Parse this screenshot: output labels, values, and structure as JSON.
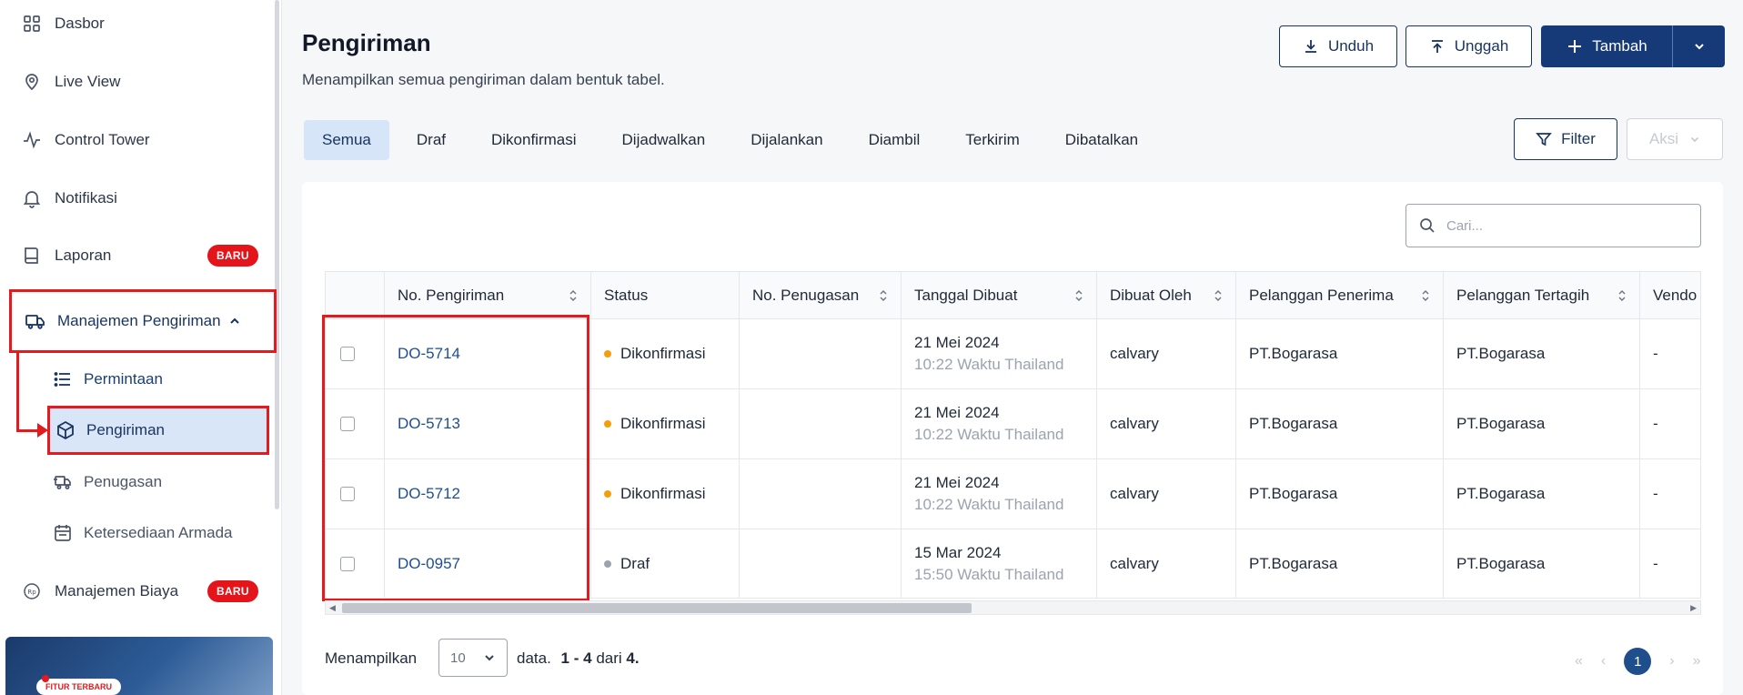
{
  "sidebar": {
    "items": [
      {
        "label": "Dasbor",
        "icon": "grid-icon"
      },
      {
        "label": "Live View",
        "icon": "location-icon"
      },
      {
        "label": "Control Tower",
        "icon": "pulse-icon"
      },
      {
        "label": "Notifikasi",
        "icon": "bell-icon"
      },
      {
        "label": "Laporan",
        "icon": "book-icon",
        "badge": "BARU"
      }
    ],
    "group": {
      "label": "Manajemen Pengiriman",
      "icon": "truck-icon"
    },
    "sub_items": [
      {
        "label": "Permintaan",
        "icon": "list-icon"
      },
      {
        "label": "Pengiriman",
        "icon": "box-icon",
        "active": true
      },
      {
        "label": "Penugasan",
        "icon": "truck-fast-icon"
      },
      {
        "label": "Ketersediaan Armada",
        "icon": "calendar-icon"
      }
    ],
    "biaya": {
      "label": "Manajemen Biaya",
      "badge": "BARU",
      "icon": "coin-icon"
    },
    "promo_label": "FITUR TERBARU"
  },
  "header": {
    "title": "Pengiriman",
    "subtitle": "Menampilkan semua pengiriman dalam bentuk tabel.",
    "unduh": "Unduh",
    "unggah": "Unggah",
    "tambah": "Tambah"
  },
  "tabs": [
    "Semua",
    "Draf",
    "Dikonfirmasi",
    "Dijadwalkan",
    "Dijalankan",
    "Diambil",
    "Terkirim",
    "Dibatalkan"
  ],
  "actions": {
    "filter": "Filter",
    "aksi": "Aksi"
  },
  "search": {
    "placeholder": "Cari..."
  },
  "table": {
    "columns": [
      "No. Pengiriman",
      "Status",
      "No. Penugasan",
      "Tanggal Dibuat",
      "Dibuat Oleh",
      "Pelanggan Penerima",
      "Pelanggan Tertagih",
      "Vendo"
    ],
    "rows": [
      {
        "no": "DO-5714",
        "status": "Dikonfirmasi",
        "status_color": "#f59e0b",
        "penugasan": "",
        "tanggal": "21 Mei 2024",
        "waktu": "10:22 Waktu Thailand",
        "oleh": "calvary",
        "penerima": "PT.Bogarasa",
        "tertagih": "PT.Bogarasa",
        "vendor": "-"
      },
      {
        "no": "DO-5713",
        "status": "Dikonfirmasi",
        "status_color": "#f59e0b",
        "penugasan": "",
        "tanggal": "21 Mei 2024",
        "waktu": "10:22 Waktu Thailand",
        "oleh": "calvary",
        "penerima": "PT.Bogarasa",
        "tertagih": "PT.Bogarasa",
        "vendor": "-"
      },
      {
        "no": "DO-5712",
        "status": "Dikonfirmasi",
        "status_color": "#f59e0b",
        "penugasan": "",
        "tanggal": "21 Mei 2024",
        "waktu": "10:22 Waktu Thailand",
        "oleh": "calvary",
        "penerima": "PT.Bogarasa",
        "tertagih": "PT.Bogarasa",
        "vendor": "-"
      },
      {
        "no": "DO-0957",
        "status": "Draf",
        "status_color": "#9ca3af",
        "penugasan": "",
        "tanggal": "15 Mar 2024",
        "waktu": "15:50 Waktu Thailand",
        "oleh": "calvary",
        "penerima": "PT.Bogarasa",
        "tertagih": "PT.Bogarasa",
        "vendor": "-"
      }
    ]
  },
  "footer": {
    "showing": "Menampilkan",
    "page_size": "10",
    "data_label": "data.",
    "range": "1 - 4",
    "of": "dari",
    "total": "4.",
    "current_page": "1"
  }
}
